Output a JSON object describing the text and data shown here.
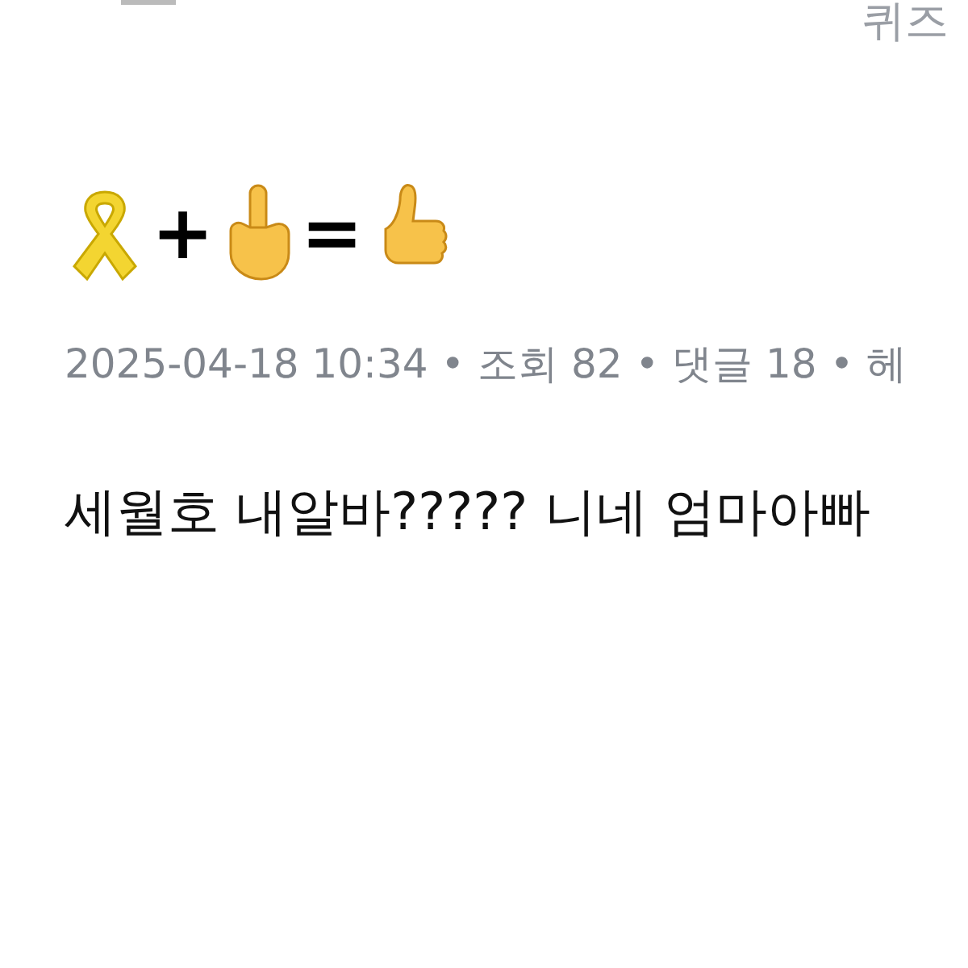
{
  "header": {
    "text": "퀴즈"
  },
  "title": {
    "operators": [
      "+",
      "="
    ]
  },
  "meta": {
    "separator": "•",
    "items": [
      "2025-04-18 10:34",
      "조회 82",
      "댓글 18",
      "헤"
    ]
  },
  "body": "세월호 내알바????? 니네 엄마아빠"
}
